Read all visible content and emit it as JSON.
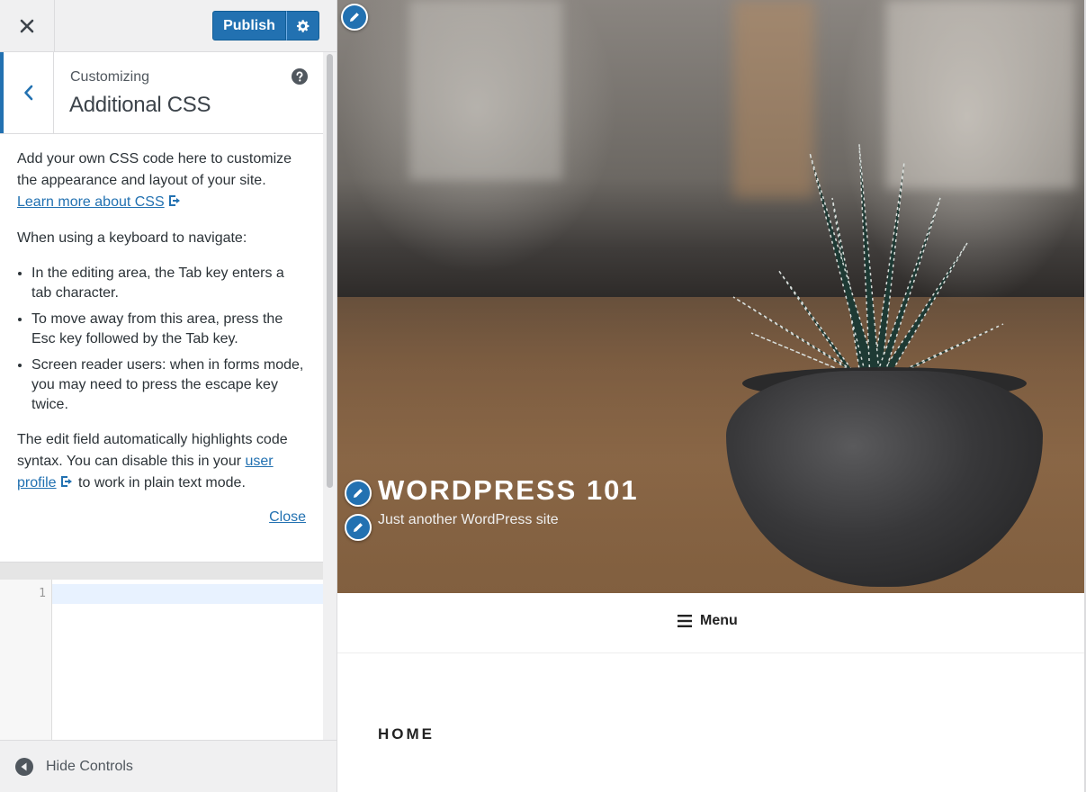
{
  "sidebar": {
    "close_label": "Close",
    "publish_label": "Publish",
    "section": {
      "breadcrumb": "Customizing",
      "title": "Additional CSS"
    },
    "description": {
      "intro": "Add your own CSS code here to customize the appearance and layout of your site.",
      "learn_more_link": "Learn more about CSS",
      "keyboard_heading": "When using a keyboard to navigate:",
      "bullets": [
        "In the editing area, the Tab key enters a tab character.",
        "To move away from this area, press the Esc key followed by the Tab key.",
        "Screen reader users: when in forms mode, you may need to press the escape key twice."
      ],
      "syntax_text_before": "The edit field automatically highlights code syntax. You can disable this in your",
      "user_profile_link": "user profile",
      "syntax_text_after": "to work in plain text mode.",
      "close_link": "Close"
    },
    "editor": {
      "line_numbers": [
        "1"
      ],
      "content": ""
    },
    "footer": {
      "hide_controls_label": "Hide Controls"
    }
  },
  "preview": {
    "site_title": "WordPress 101",
    "site_description": "Just another WordPress site",
    "menu_label": "Menu",
    "page_heading": "HOME"
  },
  "icons": {
    "close": "close-icon",
    "settings": "gear-icon",
    "back": "chevron-left-icon",
    "help": "help-icon",
    "external": "external-link-icon",
    "hide_controls": "collapse-arrow-icon",
    "edit": "pencil-icon",
    "menu": "hamburger-icon"
  },
  "colors": {
    "accent": "#2271b1",
    "sidebar_bg": "#f0f0f1",
    "active_line": "#e8f2ff"
  }
}
